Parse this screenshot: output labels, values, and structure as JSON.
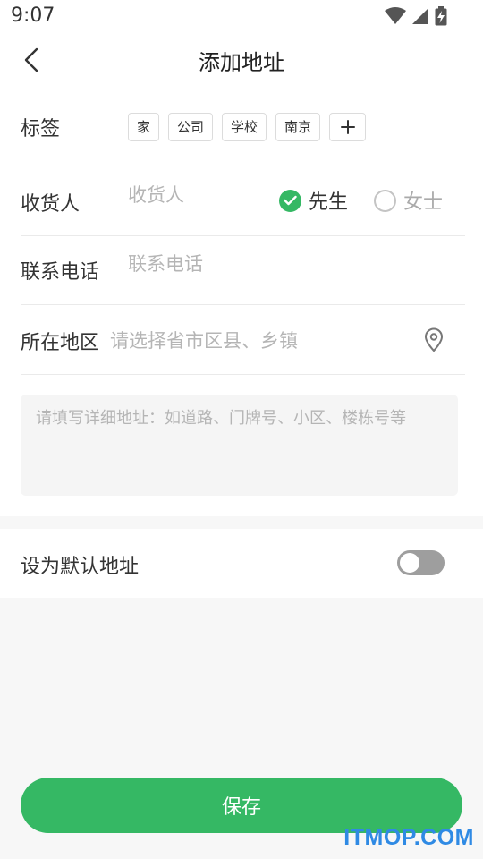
{
  "status_bar": {
    "time": "9:07",
    "icons": [
      "wifi-icon",
      "cellular-signal-icon",
      "battery-charging-icon"
    ]
  },
  "header": {
    "title": "添加地址",
    "back_icon": "chevron-left-icon"
  },
  "form": {
    "tags": {
      "label": "标签",
      "items": [
        "家",
        "公司",
        "学校",
        "南京"
      ],
      "add_icon": "plus-icon"
    },
    "receiver": {
      "label": "收货人",
      "placeholder": "收货人",
      "value": "",
      "gender_options": [
        {
          "label": "先生",
          "selected": true
        },
        {
          "label": "女士",
          "selected": false
        }
      ]
    },
    "phone": {
      "label": "联系电话",
      "placeholder": "联系电话",
      "value": ""
    },
    "region": {
      "label": "所在地区",
      "placeholder": "请选择省市区县、乡镇",
      "icon": "location-pin-icon"
    },
    "detail_address": {
      "placeholder": "请填写详细地址：如道路、门牌号、小区、楼栋号等",
      "value": ""
    }
  },
  "default_address": {
    "label": "设为默认地址",
    "enabled": false
  },
  "actions": {
    "save_label": "保存"
  },
  "watermark": "ITMOP.COM",
  "colors": {
    "accent": "#35b864",
    "toggle_off": "#9e9e9e",
    "placeholder": "#b5b5b5",
    "watermark": "#2f8ae4"
  }
}
